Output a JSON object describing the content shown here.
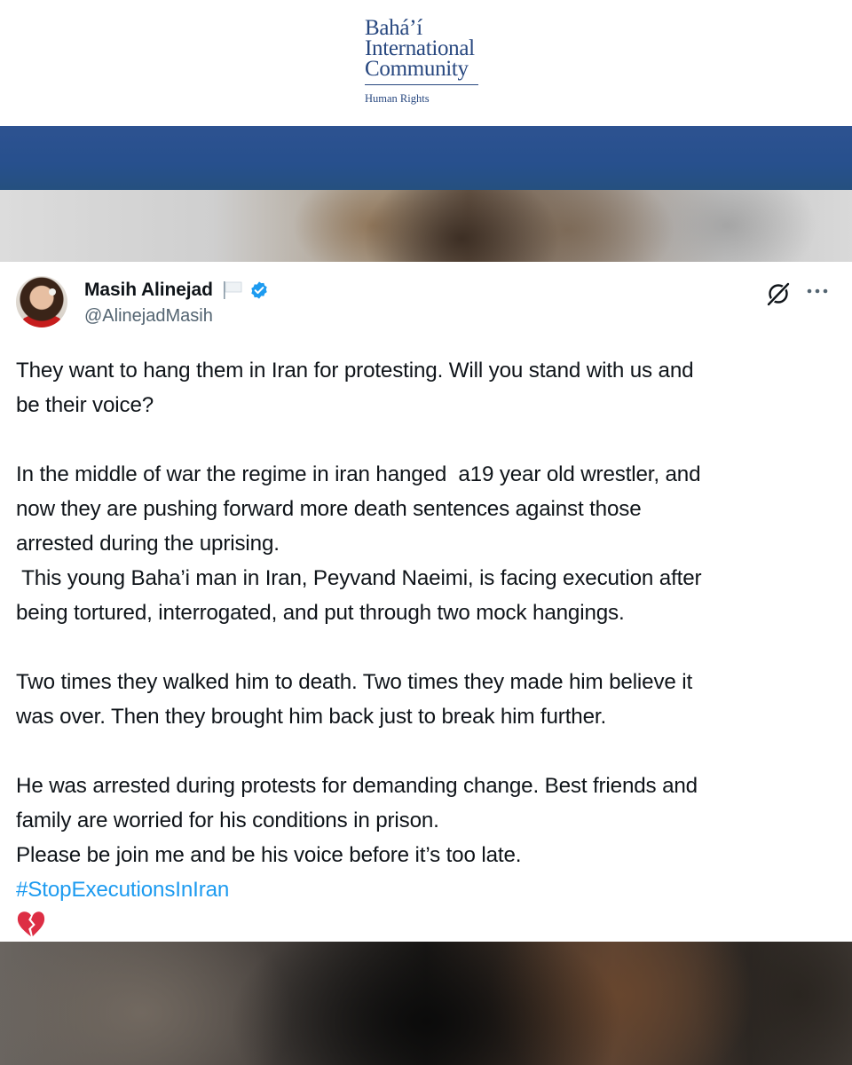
{
  "header": {
    "logo_line1": "Bahá’í",
    "logo_line2": "International",
    "logo_line3": "Community",
    "logo_sub": "Human Rights"
  },
  "tweet": {
    "display_name": "Masih Alinejad",
    "handle": "@AlinejadMasih",
    "icons": {
      "flag": "white-flag-icon",
      "verified": "verified-badge-icon",
      "grok": "grok-icon",
      "more": "more-options-icon",
      "emoji": "broken-heart-icon"
    },
    "lines": [
      "They want to hang them in Iran for protesting. Will you stand with us and",
      "be their voice?",
      "",
      "In the middle of war the regime in iran hanged  a19 year old wrestler, and",
      "now they are pushing forward more death sentences against those",
      "arrested during the uprising.",
      " This young Baha’i man in Iran, Peyvand Naeimi, is facing execution after",
      "being tortured, interrogated, and put through two mock hangings.",
      "",
      "Two times they walked him to death. Two times they made him believe it",
      "was over. Then they brought him back just to break him further.",
      "",
      "He was arrested during protests for demanding change. Best friends and",
      "family are worried for his conditions in prison.",
      "Please be join me and be his voice before it’s too late."
    ],
    "hashtag": "#StopExecutionsInIran"
  },
  "colors": {
    "brand_blue": "#27477f",
    "band_blue": "#2a5190",
    "hashtag_blue": "#1d9bf0",
    "verified_blue": "#1d9bf0",
    "text": "#0f1419",
    "handle_gray": "#536471",
    "heart_red": "#dd2e44"
  }
}
